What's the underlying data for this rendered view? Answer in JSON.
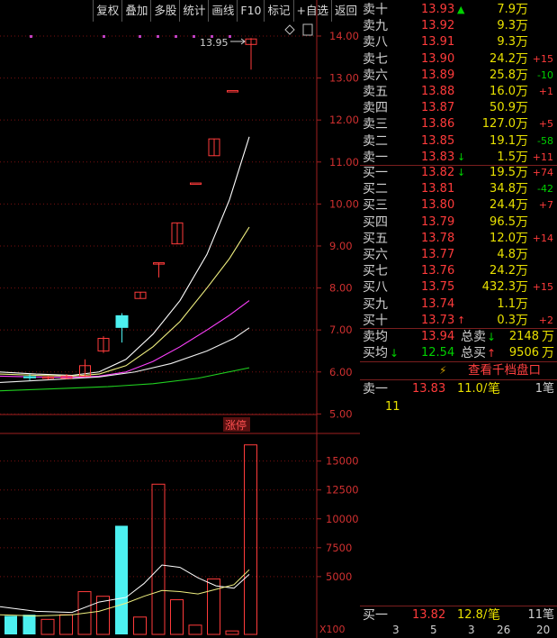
{
  "toolbar": {
    "items": [
      "复权",
      "叠加",
      "多股",
      "统计",
      "画线",
      "F10",
      "标记",
      "+自选",
      "返回"
    ]
  },
  "chart": {
    "price_axis": [
      "14.00",
      "13.00",
      "12.00",
      "11.00",
      "10.00",
      "9.00",
      "8.00",
      "7.00",
      "6.00",
      "5.00"
    ],
    "volume_axis": [
      "15000",
      "12500",
      "10000",
      "7500",
      "5000"
    ],
    "volume_unit": "X100",
    "high_label": "13.95",
    "tag": "涨停"
  },
  "chart_data": {
    "type": "candlestick",
    "candles": [
      {
        "o": 5.9,
        "c": 5.85,
        "h": 5.95,
        "l": 5.8,
        "up": false
      },
      {
        "o": 5.88,
        "c": 5.85,
        "h": 5.9,
        "l": 5.82,
        "up": true
      },
      {
        "o": 5.85,
        "c": 5.9,
        "h": 5.95,
        "l": 5.83,
        "up": true
      },
      {
        "o": 5.9,
        "c": 6.15,
        "h": 6.3,
        "l": 5.88,
        "up": true
      },
      {
        "o": 6.5,
        "c": 6.8,
        "h": 6.85,
        "l": 6.45,
        "up": true
      },
      {
        "o": 7.35,
        "c": 7.05,
        "h": 7.4,
        "l": 6.7,
        "up": false
      },
      {
        "o": 7.75,
        "c": 7.9,
        "h": 7.9,
        "l": 7.75,
        "up": true
      },
      {
        "o": 8.6,
        "c": 8.6,
        "h": 8.6,
        "l": 8.25,
        "up": true
      },
      {
        "o": 9.05,
        "c": 9.55,
        "h": 9.55,
        "l": 9.05,
        "up": true
      },
      {
        "o": 10.5,
        "c": 10.5,
        "h": 10.5,
        "l": 10.5,
        "up": true
      },
      {
        "o": 11.15,
        "c": 11.55,
        "h": 11.55,
        "l": 11.15,
        "up": true
      },
      {
        "o": 12.7,
        "c": 12.7,
        "h": 12.7,
        "l": 12.7,
        "up": true
      },
      {
        "o": 13.8,
        "c": 13.93,
        "h": 13.95,
        "l": 13.2,
        "up": true
      }
    ],
    "volumes": [
      {
        "v": 1600,
        "up": false
      },
      {
        "v": 1700,
        "up": false
      },
      {
        "v": 1300,
        "up": true
      },
      {
        "v": 1700,
        "up": true
      },
      {
        "v": 3700,
        "up": true
      },
      {
        "v": 3300,
        "up": true
      },
      {
        "v": 9400,
        "up": false
      },
      {
        "v": 1500,
        "up": true
      },
      {
        "v": 13000,
        "up": true
      },
      {
        "v": 3000,
        "up": true
      },
      {
        "v": 800,
        "up": true
      },
      {
        "v": 4800,
        "up": true
      },
      {
        "v": 300,
        "up": true
      },
      {
        "v": 16400,
        "up": true
      }
    ],
    "ylim_price": [
      4.6,
      14.3
    ],
    "ylim_volume": [
      0,
      17000
    ]
  },
  "orderbook": {
    "asks": [
      {
        "label": "卖十",
        "price": "13.93",
        "arrow": "▲",
        "arrow_color": "green",
        "vol": "7.9",
        "chg": ""
      },
      {
        "label": "卖九",
        "price": "13.92",
        "arrow": "",
        "arrow_color": "",
        "vol": "9.3",
        "chg": ""
      },
      {
        "label": "卖八",
        "price": "13.91",
        "arrow": "",
        "arrow_color": "",
        "vol": "9.3",
        "chg": ""
      },
      {
        "label": "卖七",
        "price": "13.90",
        "arrow": "",
        "arrow_color": "",
        "vol": "24.2",
        "chg": "+15"
      },
      {
        "label": "卖六",
        "price": "13.89",
        "arrow": "",
        "arrow_color": "",
        "vol": "25.8",
        "chg": "-10"
      },
      {
        "label": "卖五",
        "price": "13.88",
        "arrow": "",
        "arrow_color": "",
        "vol": "16.0",
        "chg": "+1"
      },
      {
        "label": "卖四",
        "price": "13.87",
        "arrow": "",
        "arrow_color": "",
        "vol": "50.9",
        "chg": ""
      },
      {
        "label": "卖三",
        "price": "13.86",
        "arrow": "",
        "arrow_color": "",
        "vol": "127.0",
        "chg": "+5"
      },
      {
        "label": "卖二",
        "price": "13.85",
        "arrow": "",
        "arrow_color": "",
        "vol": "19.1",
        "chg": "-58"
      },
      {
        "label": "卖一",
        "price": "13.83",
        "arrow": "↓",
        "arrow_color": "green",
        "vol": "1.5",
        "chg": "+11"
      }
    ],
    "bids": [
      {
        "label": "买一",
        "price": "13.82",
        "arrow": "↓",
        "arrow_color": "green",
        "vol": "19.5",
        "chg": "+74"
      },
      {
        "label": "买二",
        "price": "13.81",
        "arrow": "",
        "arrow_color": "",
        "vol": "34.8",
        "chg": "-42"
      },
      {
        "label": "买三",
        "price": "13.80",
        "arrow": "",
        "arrow_color": "",
        "vol": "24.4",
        "chg": "+7"
      },
      {
        "label": "买四",
        "price": "13.79",
        "arrow": "",
        "arrow_color": "",
        "vol": "96.5",
        "chg": ""
      },
      {
        "label": "买五",
        "price": "13.78",
        "arrow": "",
        "arrow_color": "",
        "vol": "12.0",
        "chg": "+14"
      },
      {
        "label": "买六",
        "price": "13.77",
        "arrow": "",
        "arrow_color": "",
        "vol": "4.8",
        "chg": ""
      },
      {
        "label": "买七",
        "price": "13.76",
        "arrow": "",
        "arrow_color": "",
        "vol": "24.2",
        "chg": ""
      },
      {
        "label": "买八",
        "price": "13.75",
        "arrow": "",
        "arrow_color": "",
        "vol": "432.3",
        "chg": "+15"
      },
      {
        "label": "买九",
        "price": "13.74",
        "arrow": "",
        "arrow_color": "",
        "vol": "1.1",
        "chg": ""
      },
      {
        "label": "买十",
        "price": "13.73",
        "arrow": "↑",
        "arrow_color": "red",
        "vol": "0.3",
        "chg": "+2"
      }
    ],
    "unit": "万",
    "avg_sell": {
      "label": "卖均",
      "price": "13.94",
      "total_label": "总卖",
      "total_arrow": "↓",
      "total": "2148",
      "unit": "万"
    },
    "avg_buy": {
      "label": "买均",
      "label_arrow": "↓",
      "price": "12.54",
      "total_label": "总买",
      "total_arrow": "↑",
      "total": "9506",
      "unit": "万"
    },
    "view_thousand": "查看千档盘口",
    "queue_top": {
      "label": "卖一",
      "price": "13.83",
      "qty": "11.0/",
      "unit": "笔",
      "count": "1笔",
      "first": "11"
    },
    "queue_bottom": {
      "label": "买一",
      "price": "13.82",
      "qty": "12.8/",
      "unit": "笔",
      "count": "11笔"
    },
    "footer_nums": [
      "3",
      "5",
      "3",
      "26",
      "20"
    ]
  },
  "colors": {
    "up": "#ff3b3b",
    "down": "#4cf0f0",
    "ma1": "#ffffff",
    "ma2": "#f0f080",
    "ma3": "#ff40ff",
    "ma4": "#f0f0f0",
    "ma5": "#20d020"
  }
}
